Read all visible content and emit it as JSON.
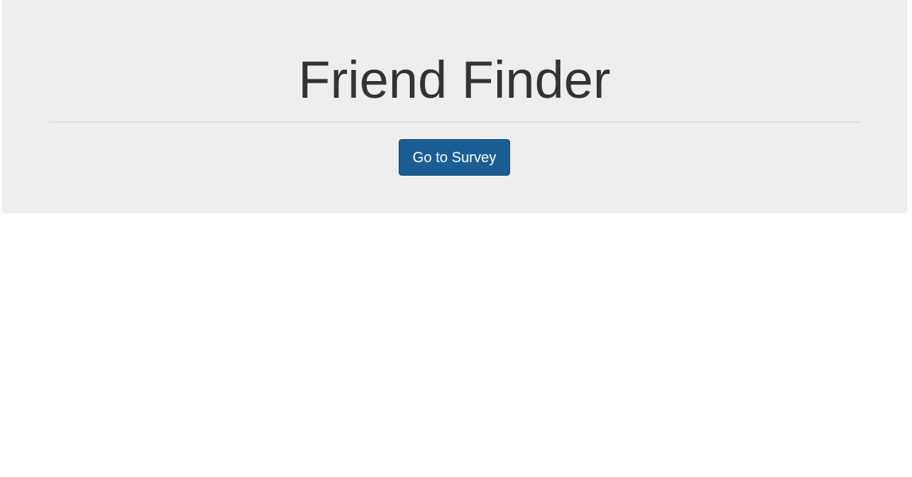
{
  "header": {
    "title": "Friend Finder"
  },
  "actions": {
    "survey_button_label": "Go to Survey"
  },
  "colors": {
    "jumbotron_bg": "#eeeeee",
    "title_text": "#333333",
    "button_bg": "#1b5e93",
    "button_text": "#ffffff"
  }
}
